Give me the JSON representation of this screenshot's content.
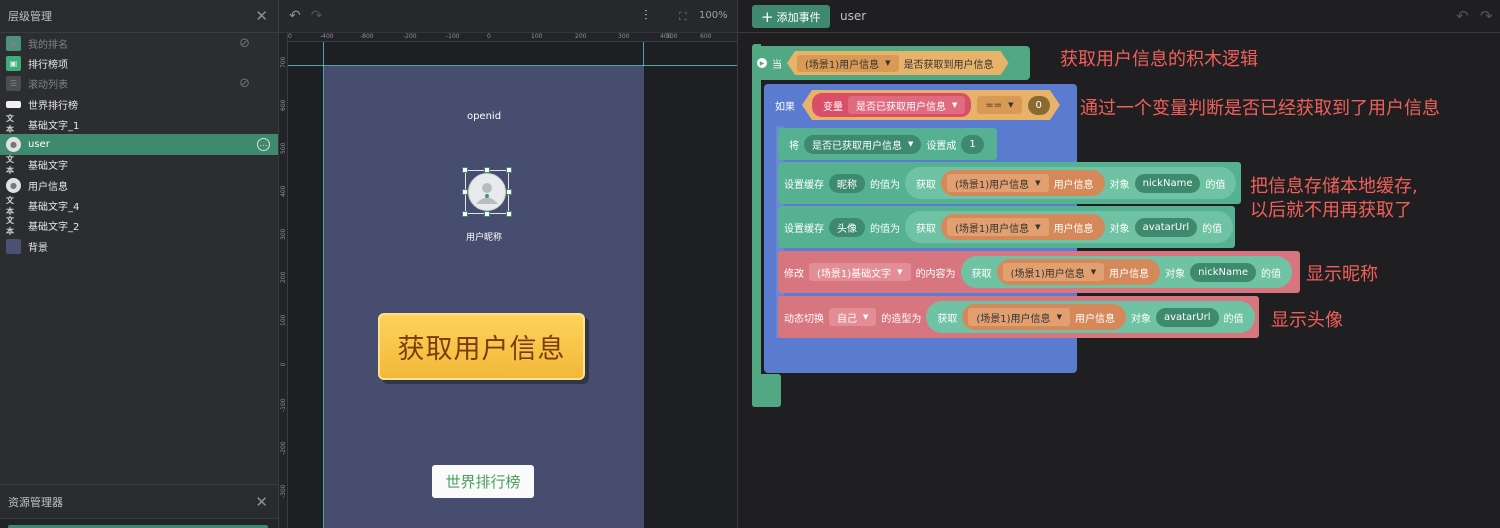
{
  "hierarchy": {
    "title": "层级管理",
    "items": [
      {
        "name": "我的排名",
        "icon": "cube-icon",
        "dim": true,
        "hidden": true
      },
      {
        "name": "排行榜项",
        "icon": "cube-icon",
        "dim": false,
        "hidden": false
      },
      {
        "name": "滚动列表",
        "icon": "list-icon",
        "dim": true,
        "hidden": true
      },
      {
        "name": "世界排行榜",
        "icon": "bar-icon",
        "dim": false,
        "hidden": false
      },
      {
        "name": "基础文字_1",
        "icon": "text-icon",
        "dim": false,
        "hidden": false
      },
      {
        "name": "user",
        "icon": "user-icon",
        "dim": false,
        "hidden": false,
        "selected": true
      },
      {
        "name": "基础文字",
        "icon": "text-icon",
        "dim": false,
        "hidden": false
      },
      {
        "name": "用户信息",
        "icon": "user-icon",
        "dim": false,
        "hidden": false
      },
      {
        "name": "基础文字_4",
        "icon": "text-icon",
        "dim": false,
        "hidden": false
      },
      {
        "name": "基础文字_2",
        "icon": "text-icon",
        "dim": false,
        "hidden": false
      },
      {
        "name": "背景",
        "icon": "rect-icon",
        "dim": false,
        "hidden": false
      }
    ]
  },
  "assets": {
    "title": "资源管理器"
  },
  "canvas": {
    "zoom": "100%",
    "ruler_h": [
      "0",
      "-400",
      "-800",
      "-200",
      "-100",
      "0",
      "100",
      "200",
      "300",
      "400",
      "500",
      "600"
    ],
    "ruler_v": [
      "700",
      "600",
      "500",
      "400",
      "300",
      "200",
      "100",
      "0",
      "-100",
      "-200",
      "-300"
    ],
    "openid_text": "openid",
    "nickname_text": "用户昵称",
    "get_button": "获取用户信息",
    "rank_button": "世界排行榜"
  },
  "blocks": {
    "add_event": "添加事件",
    "object": "user",
    "event": {
      "when": "当",
      "scene_obj": "(场景1)用户信息",
      "cond": "是否获取到用户信息"
    },
    "if_block": {
      "label": "如果",
      "var_label": "变量",
      "var_name": "是否已获取用户信息",
      "op": "==",
      "value": "0"
    },
    "set_var": {
      "label": "将",
      "var_name": "是否已获取用户信息",
      "set_to": "设置成",
      "value": "1"
    },
    "cache_nick": {
      "label": "设置缓存",
      "key": "昵称",
      "value_of": "的值为",
      "get": "获取",
      "obj": "(场景1)用户信息",
      "info": "用户信息",
      "object": "对象",
      "field": "nickName",
      "tail": "的值"
    },
    "cache_avatar": {
      "label": "设置缓存",
      "key": "头像",
      "value_of": "的值为",
      "get": "获取",
      "obj": "(场景1)用户信息",
      "info": "用户信息",
      "object": "对象",
      "field": "avatarUrl",
      "tail": "的值"
    },
    "modify": {
      "label": "修改",
      "target": "(场景1)基础文字",
      "content": "的内容为",
      "get": "获取",
      "obj": "(场景1)用户信息",
      "info": "用户信息",
      "object": "对象",
      "field": "nickName",
      "tail": "的值"
    },
    "switch": {
      "label": "动态切换",
      "target": "自己",
      "shape": "的造型为",
      "get": "获取",
      "obj": "(场景1)用户信息",
      "info": "用户信息",
      "object": "对象",
      "field": "avatarUrl",
      "tail": "的值"
    }
  },
  "annotations": {
    "a1": "获取用户信息的积木逻辑",
    "a2": "通过一个变量判断是否已经获取到了用户信息",
    "a3_line1": "把信息存储本地缓存,",
    "a3_line2": "以后就不用再获取了",
    "a4": "显示昵称",
    "a5": "显示头像"
  },
  "colors": {
    "accent": "#3f8a6e",
    "event_block": "#52a882",
    "if_block": "#5b7bd1",
    "var_block": "#d94f67",
    "cache_block": "#56b092",
    "orange_block": "#d5895a",
    "modify_block": "#d8767f",
    "annotation": "#f0605b"
  }
}
